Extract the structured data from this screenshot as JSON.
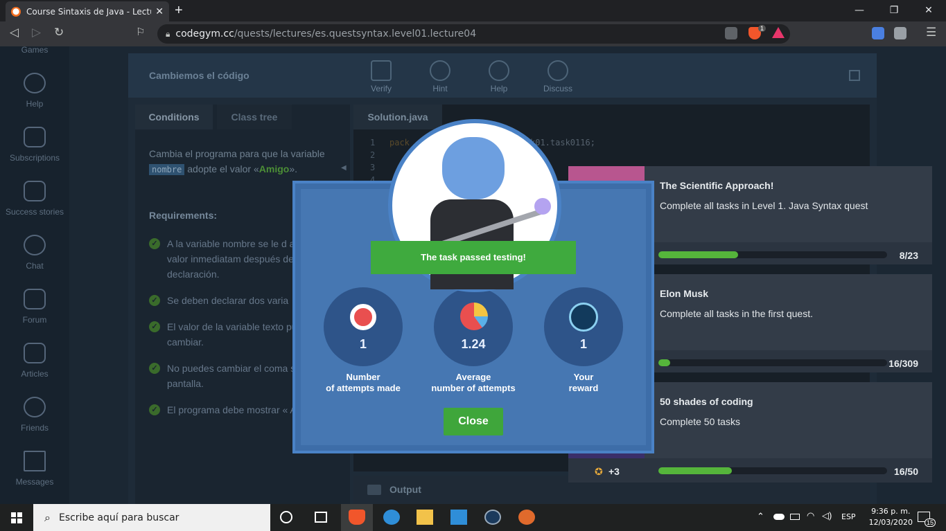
{
  "browser": {
    "tab_title": "Course Sintaxis de Java - Lecture: I",
    "url_host": "codegym.cc",
    "url_path": "/quests/lectures/es.questsyntax.level01.lecture04",
    "brave_badge": "1"
  },
  "leftnav": [
    "Games",
    "Help",
    "Subscriptions",
    "Success stories",
    "Chat",
    "Forum",
    "Articles",
    "Friends",
    "Messages"
  ],
  "header": {
    "title": "Cambiemos el código",
    "tools": [
      "Verify",
      "Hint",
      "Help",
      "Discuss"
    ]
  },
  "conditions": {
    "tab_conditions": "Conditions",
    "tab_class_tree": "Class tree",
    "text_pre": "Cambia el programa para que la variable ",
    "keyword": "nombre",
    "text_mid": " adopte el valor «",
    "value": "Amigo",
    "text_post": "».",
    "requirements_title": "Requirements:",
    "requirements": [
      "A la variable nombre se le d asignar un valor inmediatam después de su declaración.",
      "Se deben declarar dos varia",
      "El valor de la variable texto puede cambiar.",
      "No puedes cambiar el coma salida por pantalla.",
      "El programa debe mostrar « Amigo!»."
    ]
  },
  "editor": {
    "tab": "Solution.java",
    "lines": [
      "1",
      "2",
      "3",
      "4"
    ],
    "code_line1_a": "pack",
    "code_line1_b": "k01.task0116;",
    "output_label": "Output"
  },
  "achievements": [
    {
      "name": "The Scientific Approach!",
      "desc": "Complete all tasks in Level 1. Java Syntax quest",
      "progress": 0.348,
      "count": "8/23"
    },
    {
      "name": "Elon Musk",
      "desc": "Complete all tasks in the first quest.",
      "progress": 0.052,
      "count": "16/309"
    },
    {
      "name": "50 shades of coding",
      "desc": "Complete 50 tasks",
      "progress": 0.32,
      "count": "16/50",
      "reward": "+3"
    }
  ],
  "modal": {
    "banner": "The task passed testing!",
    "stats": [
      {
        "value": "1",
        "label1": "Number",
        "label2": "of attempts made"
      },
      {
        "value": "1.24",
        "label1": "Average",
        "label2": "number of attempts"
      },
      {
        "value": "1",
        "label1": "Your",
        "label2": "reward"
      }
    ],
    "close": "Close"
  },
  "taskbar": {
    "search_placeholder": "Escribe aquí para buscar",
    "lang": "ESP",
    "time": "9:36 p. m.",
    "date": "12/03/2020",
    "notif": "15"
  },
  "colors": {
    "accent_green": "#3faa3e",
    "modal_blue": "#4677b2",
    "progress_green": "#55b53b"
  }
}
